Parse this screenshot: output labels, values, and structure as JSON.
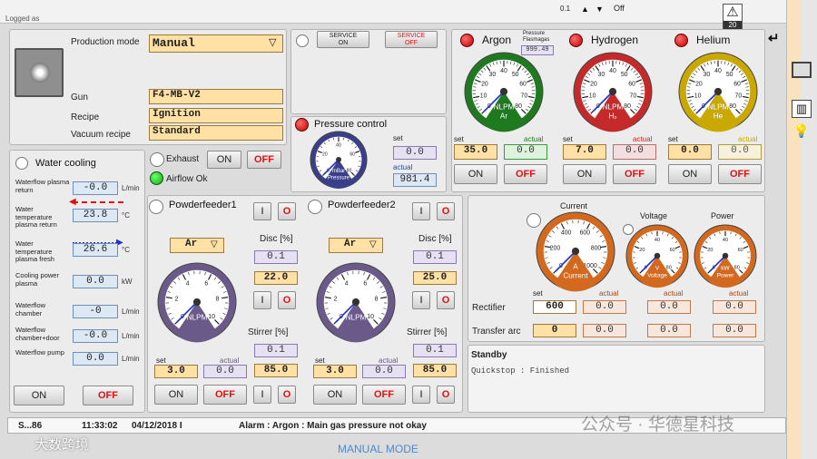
{
  "top": {
    "logged_as": "Logged as",
    "zoom": "0.1",
    "off_label": "Off",
    "warning_count": "20"
  },
  "production": {
    "mode_label": "Production mode",
    "mode_value": "Manual",
    "gun_label": "Gun",
    "gun_value": "F4-MB-V2",
    "recipe_label": "Recipe",
    "recipe_value": "Ignition",
    "vacuum_label": "Vacuum recipe",
    "vacuum_value": "Standard"
  },
  "service": {
    "on": "SERVICE\nON",
    "off": "SERVICE\nOFF"
  },
  "water": {
    "title": "Water cooling",
    "rows": [
      {
        "label": "Waterflow plasma return",
        "value": "-0.0",
        "unit": "L/min"
      },
      {
        "label": "Water temperature plasma return",
        "value": "23.8",
        "unit": "°C"
      },
      {
        "label": "Water temperature plasma fresh",
        "value": "26.6",
        "unit": "°C"
      },
      {
        "label": "Cooling power plasma",
        "value": "0.0",
        "unit": "kW"
      },
      {
        "label": "Waterflow chamber",
        "value": "-0",
        "unit": "L/min"
      },
      {
        "label": "Waterflow chamber+door",
        "value": "-0.0",
        "unit": "L/min"
      },
      {
        "label": "Waterflow pump",
        "value": "0.0",
        "unit": "L/min"
      }
    ],
    "on": "ON",
    "off": "OFF"
  },
  "exhaust": {
    "label": "Exhaust",
    "on": "ON",
    "off": "OFF",
    "airflow": "Airflow Ok"
  },
  "pressure": {
    "title": "Pressure control",
    "gauge_label": "mBar\nPressure",
    "set_label": "set",
    "set_value": "0.0",
    "actual_label": "actual",
    "actual_value": "981.4"
  },
  "gases": [
    {
      "name": "Argon",
      "flasmagas": "Pressure\nFlasmagas",
      "flasmagas_value": "999.49",
      "unit": "NLPM",
      "symbol": "Ar",
      "color": "#1f7a1f",
      "set": "35.0",
      "actual": "0.0",
      "on": "ON",
      "off": "OFF"
    },
    {
      "name": "Hydrogen",
      "unit": "NLPM",
      "symbol": "H₂",
      "color": "#c42a2a",
      "set": "7.0",
      "actual": "0.0",
      "on": "ON",
      "off": "OFF"
    },
    {
      "name": "Helium",
      "unit": "NLPM",
      "symbol": "He",
      "color": "#c9a800",
      "set": "0.0",
      "actual": "0.0",
      "on": "ON",
      "off": "OFF"
    }
  ],
  "gas_labels": {
    "set": "set",
    "actual": "actual"
  },
  "feeders": [
    {
      "title": "Powderfeeder1",
      "gas": "Ar",
      "disc_label": "Disc [%]",
      "disc_actual": "0.1",
      "disc_set": "22.0",
      "stirrer_label": "Stirrer [%]",
      "stirrer_actual": "0.1",
      "stirrer_set": "85.0",
      "set_label": "set",
      "actual_label": "actual",
      "set": "3.0",
      "actual": "0.0",
      "on": "ON",
      "off": "OFF",
      "unit": "NLPM",
      "btn_i": "I",
      "btn_o": "O"
    },
    {
      "title": "Powderfeeder2",
      "gas": "Ar",
      "disc_label": "Disc [%]",
      "disc_actual": "0.1",
      "disc_set": "25.0",
      "stirrer_label": "Stirrer [%]",
      "stirrer_actual": "0.1",
      "stirrer_set": "85.0",
      "set_label": "set",
      "actual_label": "actual",
      "set": "3.0",
      "actual": "0.0",
      "on": "ON",
      "off": "OFF",
      "unit": "NLPM",
      "btn_i": "I",
      "btn_o": "O"
    }
  ],
  "rectifier": {
    "current_title": "Current",
    "voltage_title": "Voltage",
    "power_title": "Power",
    "current_gauge": "A\nCurrent",
    "voltage_gauge": "V\nVoltage",
    "power_gauge": "kW\nPower",
    "set_label": "set",
    "actual_label": "actual",
    "rectifier_label": "Rectifier",
    "rect_set": "600",
    "rect_current": "0.0",
    "rect_voltage": "0.0",
    "rect_power": "0.0",
    "transfer_label": "Transfer arc",
    "tr_set": "0",
    "tr_current": "0.0",
    "tr_voltage": "0.0",
    "tr_power": "0.0"
  },
  "status": {
    "title": "Standby",
    "text": "Quickstop : Finished"
  },
  "footer": {
    "code": "S...86",
    "time": "11:33:02",
    "date": "04/12/2018 I",
    "alarm": "Alarm : Argon : Main gas pressure not okay",
    "mode": "MANUAL MODE"
  },
  "watermark": {
    "left": "大数跨境",
    "right": "公众号 · 华德星科技"
  }
}
